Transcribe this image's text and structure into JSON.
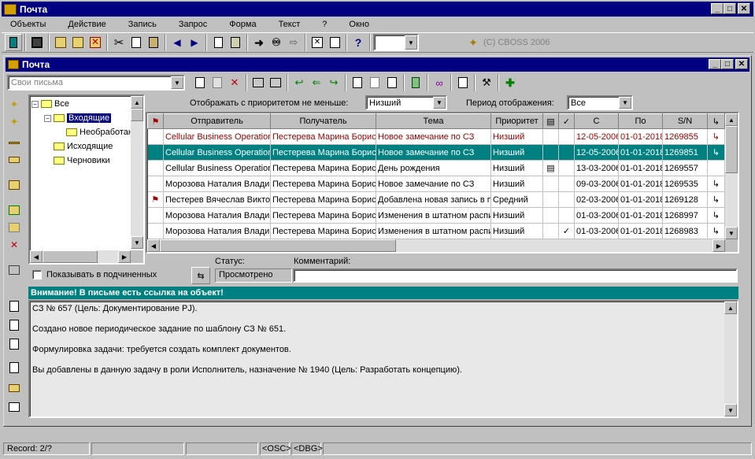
{
  "app": {
    "title": "Почта",
    "copyright": "(C) CBOSS 2006"
  },
  "menu": [
    "Объекты",
    "Действие",
    "Запись",
    "Запрос",
    "Форма",
    "Текст",
    "?",
    "Окно"
  ],
  "child": {
    "title": "Почта",
    "mailbox_combo": "Свои письма"
  },
  "tree": {
    "root": "Все",
    "inbox": "Входящие",
    "unprocessed": "Необработан",
    "outgoing": "Исходящие",
    "drafts": "Черновики"
  },
  "filters": {
    "priority_label": "Отображать с приоритетом не меньше:",
    "priority_value": "Низший",
    "period_label": "Период отображения:",
    "period_value": "Все"
  },
  "table": {
    "columns": [
      "Отправитель",
      "Получатель",
      "Тема",
      "Приоритет",
      "",
      "С",
      "По",
      "S/N"
    ],
    "rows": [
      {
        "sender": "Cellular Business Operations",
        "recipient": "Пестерева Марина Борис",
        "subject": "Новое замечание по СЗ",
        "priority": "Низший",
        "att": false,
        "check": false,
        "from": "12-05-2006",
        "to": "01-01-2018",
        "sn": "1269855",
        "flag": false,
        "arrow": true,
        "style": "red"
      },
      {
        "sender": "Cellular Business Operations",
        "recipient": "Пестерева Марина Борис",
        "subject": "Новое замечание по СЗ",
        "priority": "Низший",
        "att": false,
        "check": false,
        "from": "12-05-2006",
        "to": "01-01-2018",
        "sn": "1269851",
        "flag": false,
        "arrow": true,
        "style": "sel"
      },
      {
        "sender": "Cellular Business Operations",
        "recipient": "Пестерева Марина Борис",
        "subject": "День рождения",
        "priority": "Низший",
        "att": true,
        "check": false,
        "from": "13-03-2006",
        "to": "01-01-2018",
        "sn": "1269557",
        "flag": false,
        "arrow": false,
        "style": ""
      },
      {
        "sender": "Морозова Наталия Владим",
        "recipient": "Пестерева Марина Борис",
        "subject": "Новое замечание по СЗ",
        "priority": "Низший",
        "att": false,
        "check": false,
        "from": "09-03-2006",
        "to": "01-01-2018",
        "sn": "1269535",
        "flag": false,
        "arrow": true,
        "style": ""
      },
      {
        "sender": "Пестерев Вячеслав Викто",
        "recipient": "Пестерева Марина Борис",
        "subject": "Добавлена новая запись в п",
        "priority": "Средний",
        "att": false,
        "check": false,
        "from": "02-03-2006",
        "to": "01-01-2018",
        "sn": "1269128",
        "flag": true,
        "arrow": true,
        "style": ""
      },
      {
        "sender": "Морозова Наталия Владим",
        "recipient": "Пестерева Марина Борис",
        "subject": "Изменения в штатном распи",
        "priority": "Низший",
        "att": false,
        "check": false,
        "from": "01-03-2006",
        "to": "01-01-2018",
        "sn": "1268997",
        "flag": false,
        "arrow": true,
        "style": ""
      },
      {
        "sender": "Морозова Наталия Владим",
        "recipient": "Пестерева Марина Борис",
        "subject": "Изменения в штатном распи",
        "priority": "Низший",
        "att": false,
        "check": true,
        "from": "01-03-2006",
        "to": "01-01-2018",
        "sn": "1268983",
        "flag": false,
        "arrow": true,
        "style": ""
      }
    ]
  },
  "detail": {
    "show_sub_label": "Показывать в подчиненных",
    "status_label": "Статус:",
    "status_value": "Просмотрено",
    "comment_label": "Комментарий:",
    "comment_value": "",
    "warning": "Внимание! В письме есть ссылка на объект!",
    "body": [
      "СЗ № 657 (Цель: Документирование PJ).",
      "Создано новое периодическое задание по шаблону СЗ № 651.",
      "Формулировка задачи: требуется создать комплект документов.",
      "Вы добавлены в данную задачу в роли Исполнитель, назначение № 1940 (Цель: Разработать концепцию)."
    ]
  },
  "statusbar": {
    "record": "Record: 2/?",
    "osc": "<OSC>",
    "dbg": "<DBG>"
  },
  "colors": {
    "title_active": "#000080",
    "selection": "#008080",
    "unread": "#a00000",
    "face": "#c0c0c0"
  }
}
